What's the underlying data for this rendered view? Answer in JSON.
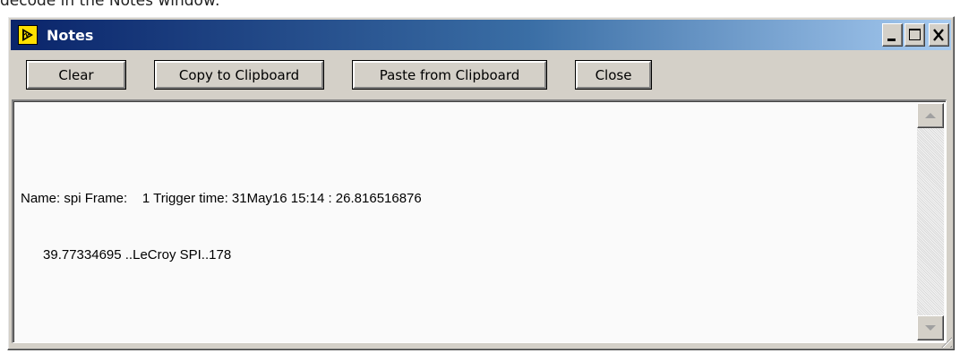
{
  "page_caption": "decode in the Notes window:",
  "window": {
    "title": "Notes",
    "controls": {
      "minimize_icon": "minimize-icon",
      "maximize_icon": "maximize-icon",
      "close_icon": "close-icon"
    }
  },
  "toolbar": {
    "clear_label": "Clear",
    "copy_label": "Copy to Clipboard",
    "paste_label": "Paste from Clipboard",
    "close_label": "Close"
  },
  "notes": {
    "line1": "Name: spi Frame:    1 Trigger time: 31May16 15:14 : 26.816516876",
    "line2": "      39.77334695 ..LeCroy SPI..178"
  },
  "colors": {
    "title_gradient_start": "#0a246a",
    "title_gradient_end": "#a6caf0",
    "window_face": "#d4d0c8",
    "text_area_bg": "#fafafa"
  }
}
